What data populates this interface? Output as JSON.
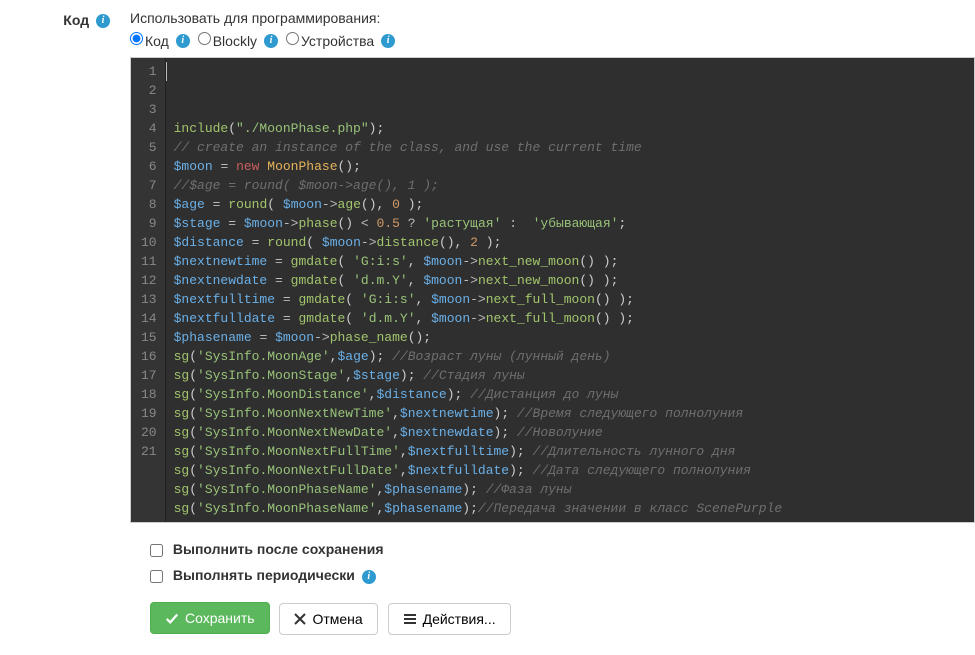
{
  "label": "Код",
  "heading": "Использовать для программирования:",
  "radios": [
    {
      "label": "Код",
      "checked": true
    },
    {
      "label": "Blockly",
      "checked": false
    },
    {
      "label": "Устройства",
      "checked": false
    }
  ],
  "code_lines": [
    [
      [
        "fn",
        "include"
      ],
      [
        "p",
        "("
      ],
      [
        "str",
        "\"./MoonPhase.php\""
      ],
      [
        "p",
        ");"
      ]
    ],
    [
      [
        "cmt",
        "// create an instance of the class, and use the current time"
      ]
    ],
    [
      [
        "var",
        "$moon"
      ],
      [
        "p",
        " "
      ],
      [
        "op",
        "="
      ],
      [
        "p",
        " "
      ],
      [
        "kw",
        "new"
      ],
      [
        "p",
        " "
      ],
      [
        "type",
        "MoonPhase"
      ],
      [
        "p",
        "();"
      ]
    ],
    [
      [
        "cmt",
        "//$age = round( $moon->age(), 1 );"
      ]
    ],
    [
      [
        "var",
        "$age"
      ],
      [
        "p",
        " "
      ],
      [
        "op",
        "="
      ],
      [
        "p",
        " "
      ],
      [
        "fn",
        "round"
      ],
      [
        "p",
        "( "
      ],
      [
        "var",
        "$moon"
      ],
      [
        "op",
        "->"
      ],
      [
        "fn",
        "age"
      ],
      [
        "p",
        "(), "
      ],
      [
        "num",
        "0"
      ],
      [
        "p",
        " );"
      ]
    ],
    [
      [
        "var",
        "$stage"
      ],
      [
        "p",
        " "
      ],
      [
        "op",
        "="
      ],
      [
        "p",
        " "
      ],
      [
        "var",
        "$moon"
      ],
      [
        "op",
        "->"
      ],
      [
        "fn",
        "phase"
      ],
      [
        "p",
        "() "
      ],
      [
        "op",
        "<"
      ],
      [
        "p",
        " "
      ],
      [
        "num",
        "0.5"
      ],
      [
        "p",
        " "
      ],
      [
        "op",
        "?"
      ],
      [
        "p",
        " "
      ],
      [
        "str",
        "'растущая'"
      ],
      [
        "p",
        " "
      ],
      [
        "op",
        ":"
      ],
      [
        "p",
        "  "
      ],
      [
        "str",
        "'убывающая'"
      ],
      [
        "p",
        ";"
      ]
    ],
    [
      [
        "var",
        "$distance"
      ],
      [
        "p",
        " "
      ],
      [
        "op",
        "="
      ],
      [
        "p",
        " "
      ],
      [
        "fn",
        "round"
      ],
      [
        "p",
        "( "
      ],
      [
        "var",
        "$moon"
      ],
      [
        "op",
        "->"
      ],
      [
        "fn",
        "distance"
      ],
      [
        "p",
        "(), "
      ],
      [
        "num",
        "2"
      ],
      [
        "p",
        " );"
      ]
    ],
    [
      [
        "var",
        "$nextnewtime"
      ],
      [
        "p",
        " "
      ],
      [
        "op",
        "="
      ],
      [
        "p",
        " "
      ],
      [
        "fn",
        "gmdate"
      ],
      [
        "p",
        "( "
      ],
      [
        "str",
        "'G:i:s'"
      ],
      [
        "p",
        ", "
      ],
      [
        "var",
        "$moon"
      ],
      [
        "op",
        "->"
      ],
      [
        "fn",
        "next_new_moon"
      ],
      [
        "p",
        "() );"
      ]
    ],
    [
      [
        "var",
        "$nextnewdate"
      ],
      [
        "p",
        " "
      ],
      [
        "op",
        "="
      ],
      [
        "p",
        " "
      ],
      [
        "fn",
        "gmdate"
      ],
      [
        "p",
        "( "
      ],
      [
        "str",
        "'d.m.Y'"
      ],
      [
        "p",
        ", "
      ],
      [
        "var",
        "$moon"
      ],
      [
        "op",
        "->"
      ],
      [
        "fn",
        "next_new_moon"
      ],
      [
        "p",
        "() );"
      ]
    ],
    [
      [
        "var",
        "$nextfulltime"
      ],
      [
        "p",
        " "
      ],
      [
        "op",
        "="
      ],
      [
        "p",
        " "
      ],
      [
        "fn",
        "gmdate"
      ],
      [
        "p",
        "( "
      ],
      [
        "str",
        "'G:i:s'"
      ],
      [
        "p",
        ", "
      ],
      [
        "var",
        "$moon"
      ],
      [
        "op",
        "->"
      ],
      [
        "fn",
        "next_full_moon"
      ],
      [
        "p",
        "() );"
      ]
    ],
    [
      [
        "var",
        "$nextfulldate"
      ],
      [
        "p",
        " "
      ],
      [
        "op",
        "="
      ],
      [
        "p",
        " "
      ],
      [
        "fn",
        "gmdate"
      ],
      [
        "p",
        "( "
      ],
      [
        "str",
        "'d.m.Y'"
      ],
      [
        "p",
        ", "
      ],
      [
        "var",
        "$moon"
      ],
      [
        "op",
        "->"
      ],
      [
        "fn",
        "next_full_moon"
      ],
      [
        "p",
        "() );"
      ]
    ],
    [
      [
        "var",
        "$phasename"
      ],
      [
        "p",
        " "
      ],
      [
        "op",
        "="
      ],
      [
        "p",
        " "
      ],
      [
        "var",
        "$moon"
      ],
      [
        "op",
        "->"
      ],
      [
        "fn",
        "phase_name"
      ],
      [
        "p",
        "();"
      ]
    ],
    [
      [
        "fn",
        "sg"
      ],
      [
        "p",
        "("
      ],
      [
        "str",
        "'SysInfo.MoonAge'"
      ],
      [
        "p",
        ","
      ],
      [
        "var",
        "$age"
      ],
      [
        "p",
        "); "
      ],
      [
        "cmt",
        "//Возраст луны (лунный день)"
      ]
    ],
    [
      [
        "fn",
        "sg"
      ],
      [
        "p",
        "("
      ],
      [
        "str",
        "'SysInfo.MoonStage'"
      ],
      [
        "p",
        ","
      ],
      [
        "var",
        "$stage"
      ],
      [
        "p",
        "); "
      ],
      [
        "cmt",
        "//Стадия луны"
      ]
    ],
    [
      [
        "fn",
        "sg"
      ],
      [
        "p",
        "("
      ],
      [
        "str",
        "'SysInfo.MoonDistance'"
      ],
      [
        "p",
        ","
      ],
      [
        "var",
        "$distance"
      ],
      [
        "p",
        "); "
      ],
      [
        "cmt",
        "//Дистанция до луны"
      ]
    ],
    [
      [
        "fn",
        "sg"
      ],
      [
        "p",
        "("
      ],
      [
        "str",
        "'SysInfo.MoonNextNewTime'"
      ],
      [
        "p",
        ","
      ],
      [
        "var",
        "$nextnewtime"
      ],
      [
        "p",
        "); "
      ],
      [
        "cmt",
        "//Время следующего полнолуния"
      ]
    ],
    [
      [
        "fn",
        "sg"
      ],
      [
        "p",
        "("
      ],
      [
        "str",
        "'SysInfo.MoonNextNewDate'"
      ],
      [
        "p",
        ","
      ],
      [
        "var",
        "$nextnewdate"
      ],
      [
        "p",
        "); "
      ],
      [
        "cmt",
        "//Новолуние"
      ]
    ],
    [
      [
        "fn",
        "sg"
      ],
      [
        "p",
        "("
      ],
      [
        "str",
        "'SysInfo.MoonNextFullTime'"
      ],
      [
        "p",
        ","
      ],
      [
        "var",
        "$nextfulltime"
      ],
      [
        "p",
        "); "
      ],
      [
        "cmt",
        "//Длительность лунного дня"
      ]
    ],
    [
      [
        "fn",
        "sg"
      ],
      [
        "p",
        "("
      ],
      [
        "str",
        "'SysInfo.MoonNextFullDate'"
      ],
      [
        "p",
        ","
      ],
      [
        "var",
        "$nextfulldate"
      ],
      [
        "p",
        "); "
      ],
      [
        "cmt",
        "//Дата следующего полнолуния"
      ]
    ],
    [
      [
        "fn",
        "sg"
      ],
      [
        "p",
        "("
      ],
      [
        "str",
        "'SysInfo.MoonPhaseName'"
      ],
      [
        "p",
        ","
      ],
      [
        "var",
        "$phasename"
      ],
      [
        "p",
        "); "
      ],
      [
        "cmt",
        "//Фаза луны"
      ]
    ],
    [
      [
        "fn",
        "sg"
      ],
      [
        "p",
        "("
      ],
      [
        "str",
        "'SysInfo.MoonPhaseName'"
      ],
      [
        "p",
        ","
      ],
      [
        "var",
        "$phasename"
      ],
      [
        "p",
        ");"
      ],
      [
        "cmt",
        "//Передача значении в класс ScenePurple"
      ]
    ]
  ],
  "checkbox_after_save": "Выполнить после сохранения",
  "checkbox_periodic": "Выполнять периодически",
  "btn_save": "Сохранить",
  "btn_cancel": "Отмена",
  "btn_actions": "Действия..."
}
